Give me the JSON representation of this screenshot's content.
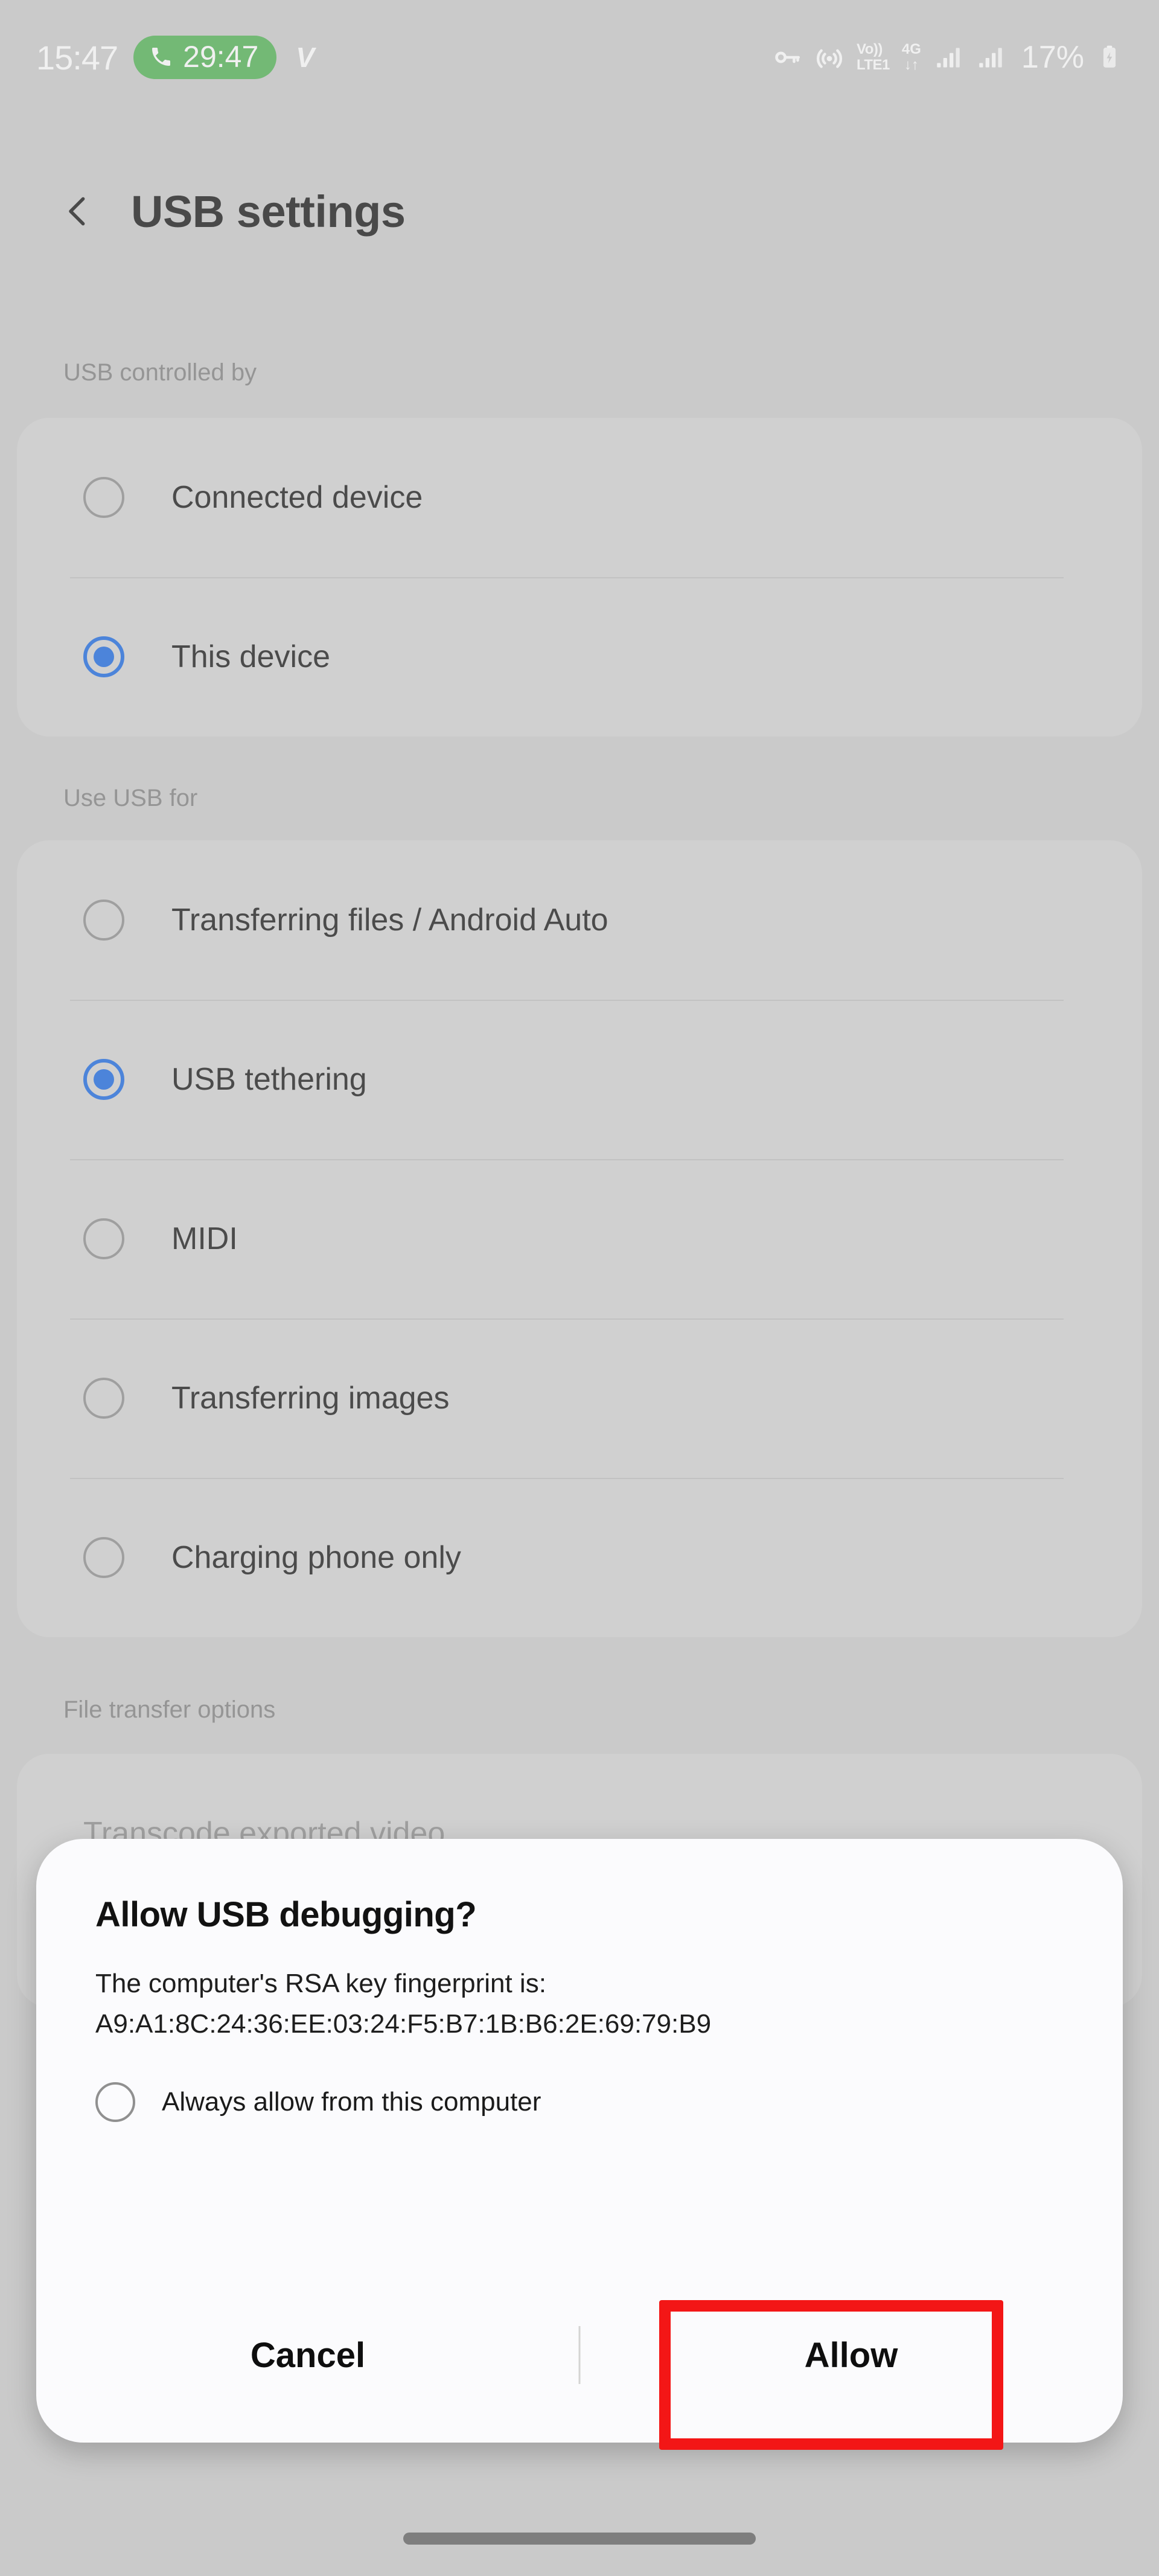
{
  "status_bar": {
    "clock": "15:47",
    "call_pill": {
      "icon": "phone-call-icon",
      "duration": "29:47",
      "color": "#4cb050"
    },
    "vpn_badge": "V",
    "icons": [
      "key-icon",
      "hotspot-icon"
    ],
    "volte_top": "Vo))",
    "volte_bottom": "LTE1",
    "network_top": "4G",
    "network_bottom": "↓↑",
    "signal_bars": [
      "signal-bars-sim1-icon",
      "signal-bars-sim2-icon"
    ],
    "battery_percent": "17%",
    "battery_icon": "battery-charging-icon"
  },
  "header": {
    "back_icon": "back-chevron-icon",
    "title": "USB settings"
  },
  "sections": [
    {
      "label": "USB controlled by",
      "options": [
        {
          "label": "Connected device",
          "selected": false
        },
        {
          "label": "This device",
          "selected": true
        }
      ]
    },
    {
      "label": "Use USB for",
      "options": [
        {
          "label": "Transferring files / Android Auto",
          "selected": false
        },
        {
          "label": "USB tethering",
          "selected": true
        },
        {
          "label": "MIDI",
          "selected": false
        },
        {
          "label": "Transferring images",
          "selected": false
        },
        {
          "label": "Charging phone only",
          "selected": false
        }
      ]
    },
    {
      "label": "File transfer options",
      "options": [
        {
          "label": "Transcode exported video",
          "selected": false
        }
      ]
    }
  ],
  "dialog": {
    "title": "Allow USB debugging?",
    "body_line_1": "The computer's RSA key fingerprint is:",
    "fingerprint": "A9:A1:8C:24:36:EE:03:24:F5:B7:1B:B6:2E:69:79:B9",
    "checkbox_label": "Always allow from this computer",
    "checkbox_checked": false,
    "cancel_label": "Cancel",
    "allow_label": "Allow",
    "highlight_color": "#f31616",
    "accent_color": "#1565e0"
  },
  "nav": {
    "gesture_handle": "home-gesture-bar"
  }
}
